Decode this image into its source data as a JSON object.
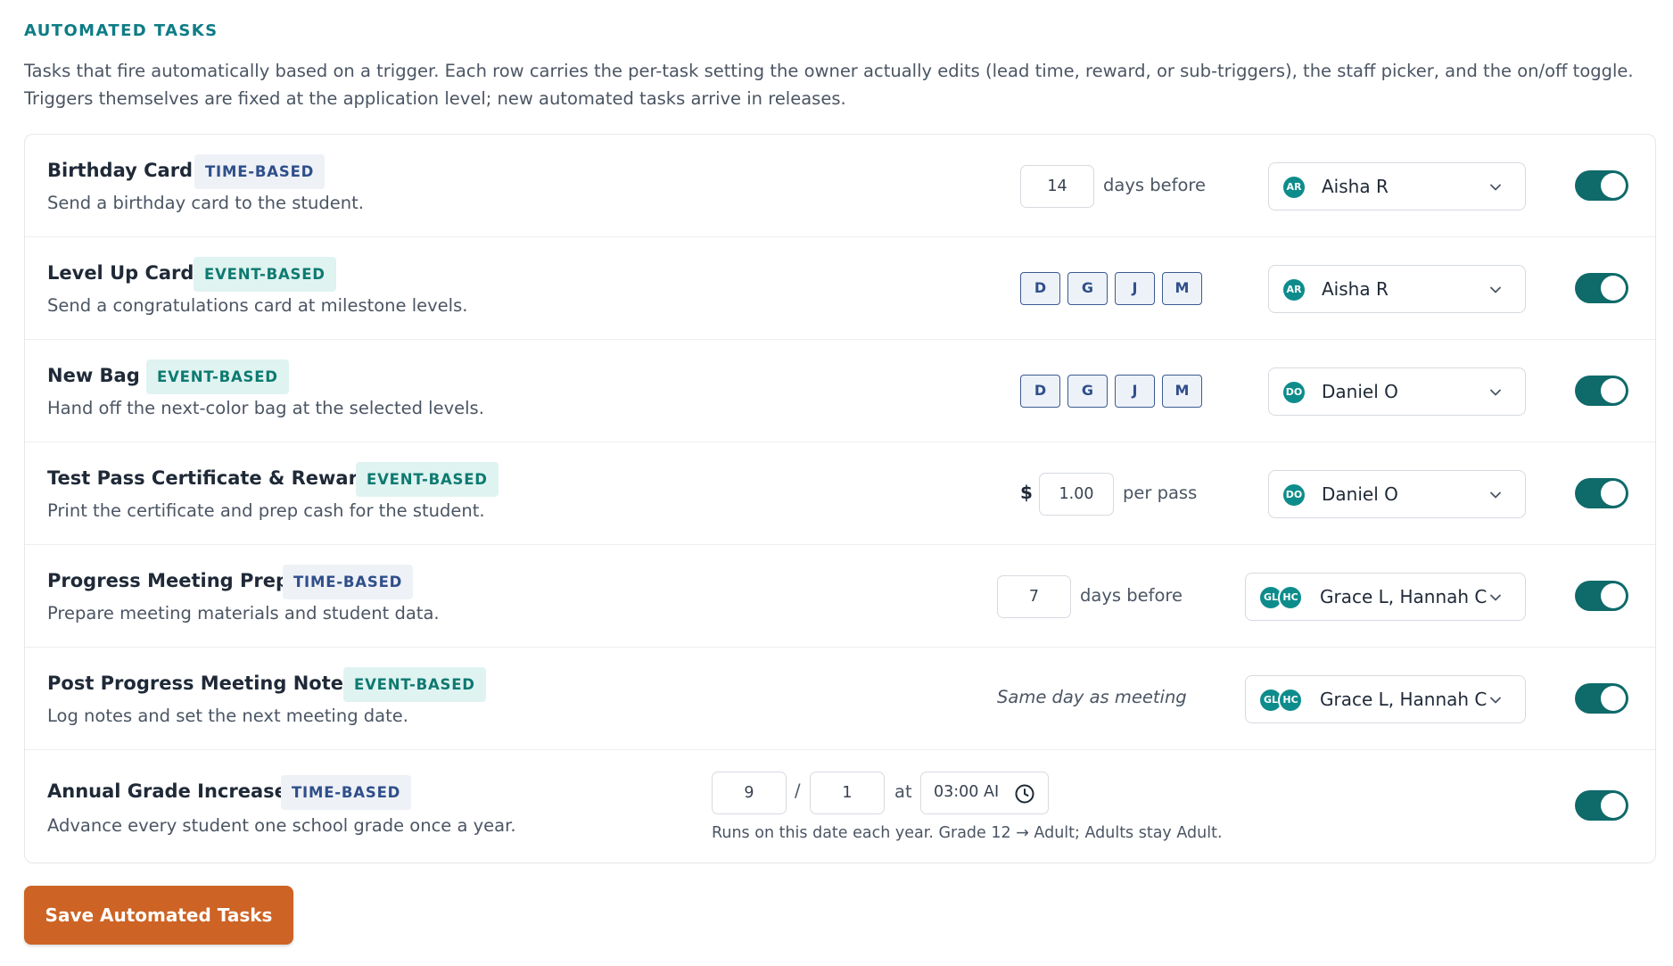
{
  "section": {
    "title": "AUTOMATED TASKS",
    "description_line1": "Tasks that fire automatically based on a trigger. Each row carries the per-task setting the owner actually edits (lead time, reward, or sub-triggers), the staff picker, and the on/off toggle.",
    "description_line2": "Triggers themselves are fixed at the application level; new automated tasks arrive in releases."
  },
  "tasks": [
    {
      "name": "Birthday Card",
      "tag": "TIME-BASED",
      "desc": "Send a birthday card to the student.",
      "lead_value": "14",
      "lead_suffix": "days before",
      "staff": {
        "avatars": [
          "AR"
        ],
        "name": "Aisha R"
      },
      "enabled": true
    },
    {
      "name": "Level Up Card",
      "tag": "EVENT-BASED",
      "desc": "Send a congratulations card at milestone levels.",
      "levels": [
        "D",
        "G",
        "J",
        "M"
      ],
      "staff": {
        "avatars": [
          "AR"
        ],
        "name": "Aisha R"
      },
      "enabled": true
    },
    {
      "name": "New Bag",
      "tag": "EVENT-BASED",
      "desc": "Hand off the next-color bag at the selected levels.",
      "levels": [
        "D",
        "G",
        "J",
        "M"
      ],
      "staff": {
        "avatars": [
          "DO"
        ],
        "name": "Daniel O"
      },
      "enabled": true
    },
    {
      "name": "Test Pass Certificate & Reward",
      "tag": "EVENT-BASED",
      "desc": "Print the certificate and prep cash for the student.",
      "currency": "$",
      "reward_value": "1.00",
      "reward_suffix": "per pass",
      "staff": {
        "avatars": [
          "DO"
        ],
        "name": "Daniel O"
      },
      "enabled": true
    },
    {
      "name": "Progress Meeting Prep",
      "tag": "TIME-BASED",
      "desc": "Prepare meeting materials and student data.",
      "lead_value": "7",
      "lead_suffix": "days before",
      "staff": {
        "avatars": [
          "GL",
          "HC"
        ],
        "name": "Grace L, Hannah C"
      },
      "enabled": true
    },
    {
      "name": "Post Progress Meeting Notes",
      "tag": "EVENT-BASED",
      "desc": "Log notes and set the next meeting date.",
      "note": "Same day as meeting",
      "staff": {
        "avatars": [
          "GL",
          "HC"
        ],
        "name": "Grace L, Hannah C"
      },
      "enabled": true
    },
    {
      "name": "Annual Grade Increase",
      "tag": "TIME-BASED",
      "desc": "Advance every student one school grade once a year.",
      "month": "9",
      "separator": "/",
      "day": "1",
      "at_label": "at",
      "time": "03:00 AI",
      "helper": "Runs on this date each year. Grade 12 → Adult; Adults stay Adult.",
      "enabled": true
    }
  ],
  "save_label": "Save Automated Tasks",
  "colors": {
    "accent_teal": "#0e7c86",
    "toggle_on": "#0f6a6a",
    "save_button": "#cd6324",
    "time_tag_bg": "#eef1f6",
    "event_tag_bg": "#dff3f1"
  }
}
